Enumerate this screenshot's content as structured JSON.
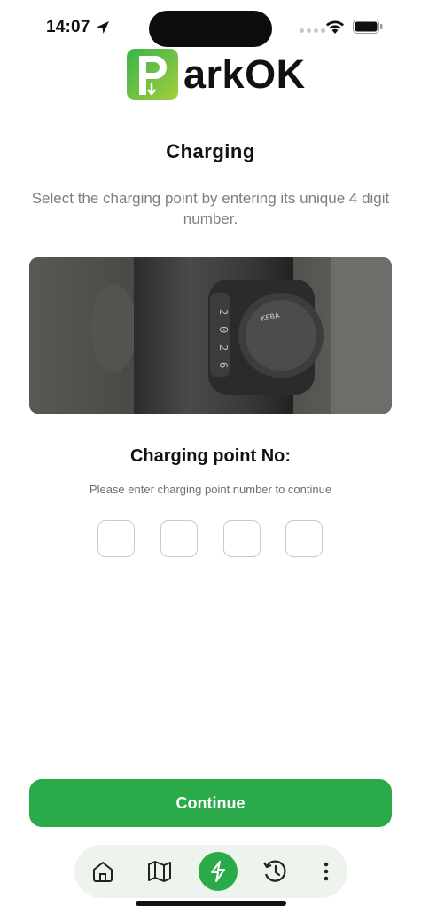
{
  "status_bar": {
    "time": "14:07"
  },
  "logo": {
    "letter": "P",
    "text": "arkOK"
  },
  "page": {
    "title": "Charging",
    "subtitle": "Select the charging point by entering its unique 4 digit number."
  },
  "photo": {
    "digits": [
      "2",
      "0",
      "2",
      "6"
    ],
    "brand": "KEBA"
  },
  "charging_point": {
    "label": "Charging point No:",
    "hint": "Please enter charging point number to continue",
    "digits": [
      "",
      "",
      "",
      ""
    ]
  },
  "actions": {
    "continue_label": "Continue"
  },
  "nav": {
    "items": [
      {
        "icon": "home-icon",
        "active": false
      },
      {
        "icon": "map-icon",
        "active": false
      },
      {
        "icon": "lightning-icon",
        "active": true
      },
      {
        "icon": "history-icon",
        "active": false
      },
      {
        "icon": "more-vertical-icon",
        "active": false
      }
    ]
  },
  "colors": {
    "primary": "#2aaa48",
    "nav_bg": "#edf3ed",
    "subtitle": "#7d7d85"
  }
}
